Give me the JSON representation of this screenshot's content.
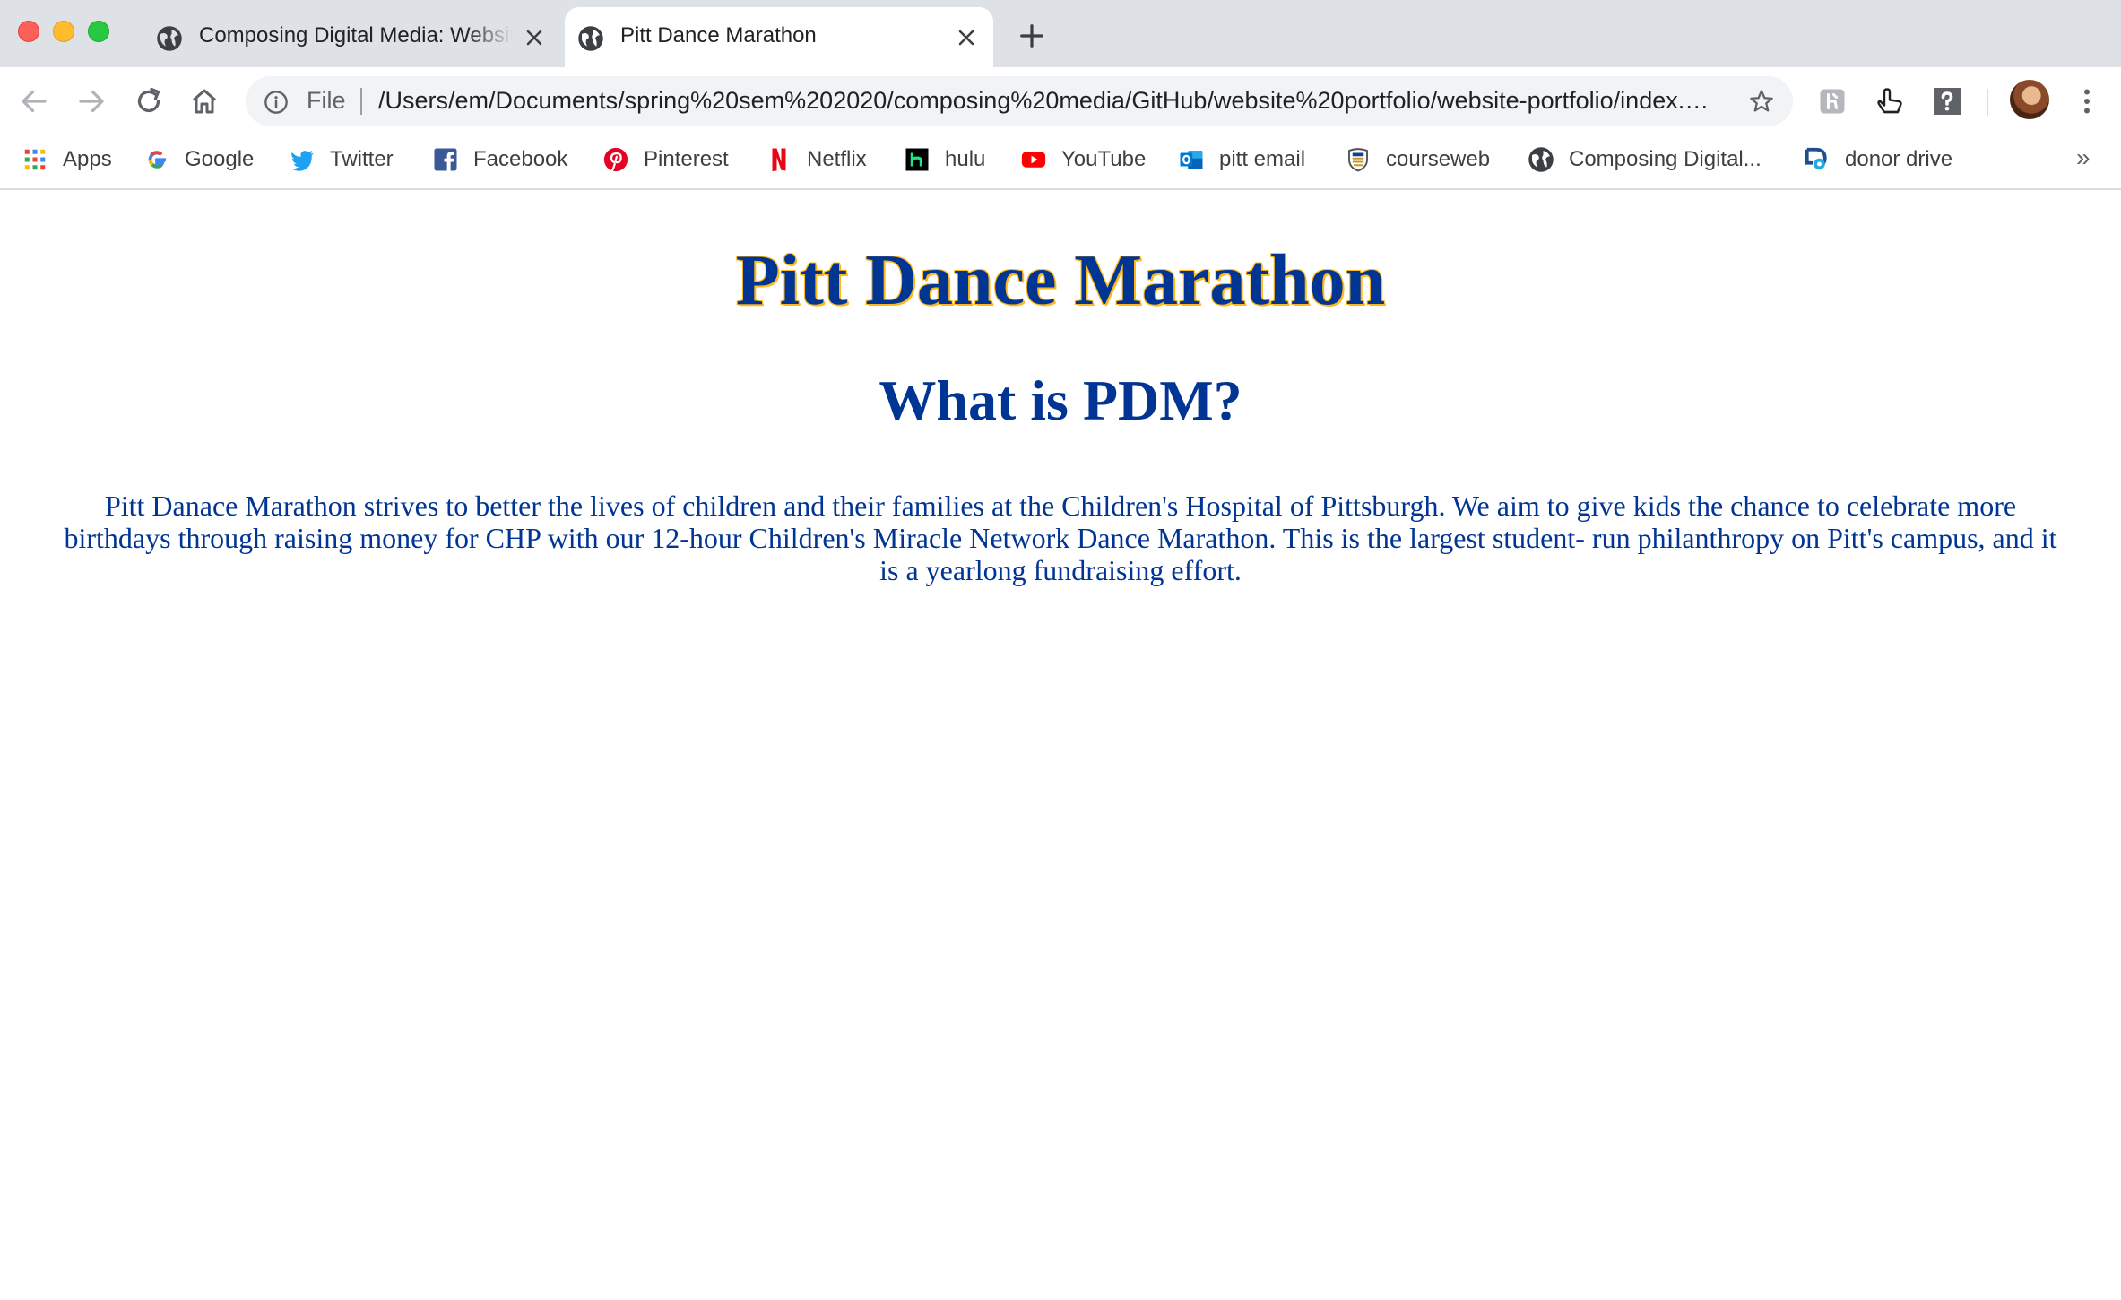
{
  "browser": {
    "tabs": [
      {
        "title": "Composing Digital Media: Website Portfolio",
        "active": false
      },
      {
        "title": "Pitt Dance Marathon",
        "active": true
      }
    ],
    "address_bar": {
      "scheme_label": "File",
      "url": "/Users/em/Documents/spring%20sem%202020/composing%20media/GitHub/website%20portfolio/website-portfolio/index.html"
    },
    "bookmarks": [
      {
        "label": "Apps",
        "icon": "apps-grid-icon"
      },
      {
        "label": "Google",
        "icon": "google-icon"
      },
      {
        "label": "Twitter",
        "icon": "twitter-icon"
      },
      {
        "label": "Facebook",
        "icon": "facebook-icon"
      },
      {
        "label": "Pinterest",
        "icon": "pinterest-icon"
      },
      {
        "label": "Netflix",
        "icon": "netflix-icon"
      },
      {
        "label": "hulu",
        "icon": "hulu-icon"
      },
      {
        "label": "YouTube",
        "icon": "youtube-icon"
      },
      {
        "label": "pitt email",
        "icon": "outlook-icon"
      },
      {
        "label": "courseweb",
        "icon": "pitt-shield-icon"
      },
      {
        "label": "Composing Digital...",
        "icon": "globe-icon"
      },
      {
        "label": "donor drive",
        "icon": "donordrive-icon"
      }
    ],
    "overflow_label": "»"
  },
  "page": {
    "title": "Pitt Dance Marathon",
    "subtitle": "What is PDM?",
    "description": "Pitt Danace Marathon strives to better the lives of children and their families at the Children's Hospital of Pittsburgh. We aim to give kids the chance to celebrate more birthdays through raising money for CHP with our 12-hour Children's Miracle Network Dance Marathon. This is the largest student- run philanthropy on Pitt's campus, and it is a yearlong fundraising effort."
  },
  "colors": {
    "pitt_blue": "#003594",
    "pitt_gold": "#ffb81c",
    "tabstrip_bg": "#dee1e6"
  }
}
